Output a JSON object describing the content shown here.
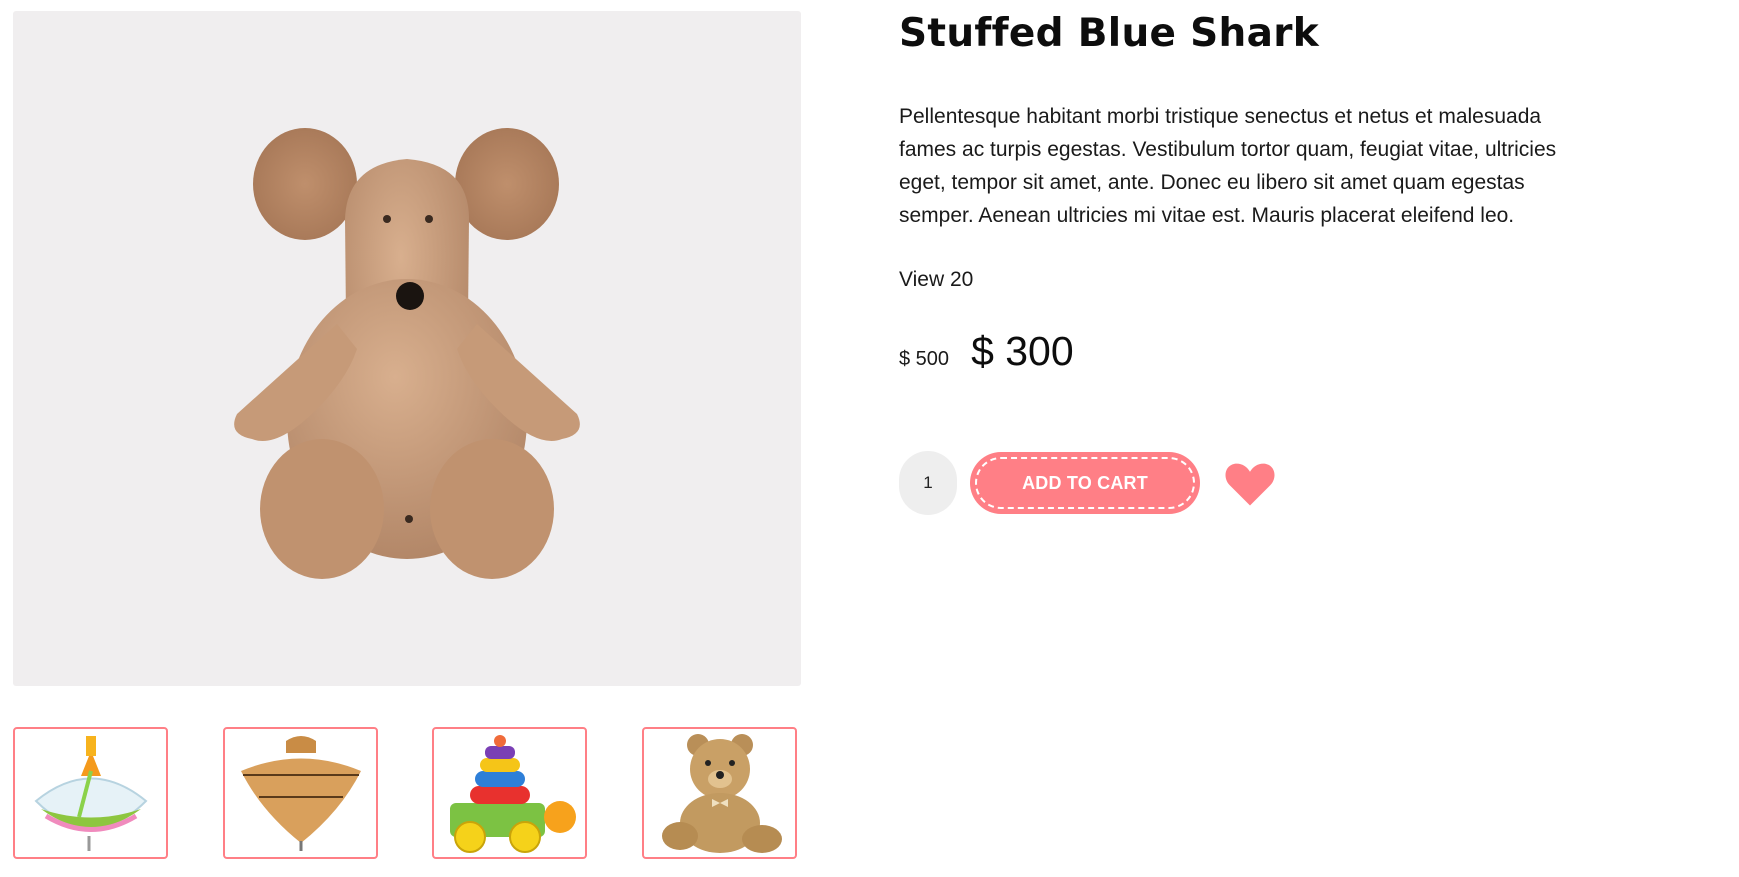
{
  "product": {
    "title": "Stuffed Blue Shark",
    "description": "Pellentesque habitant morbi tristique senectus et netus et malesuada fames ac turpis egestas. Vestibulum tortor quam, feugiat vitae, ultricies eget, tempor sit amet, ante. Donec eu libero sit amet quam egestas semper. Aenean ultricies mi vitae est. Mauris placerat eleifend leo.",
    "views": "View 20",
    "old_price": "$ 500",
    "price": "$ 300"
  },
  "cart": {
    "quantity": "1",
    "add_label": "ADD TO CART"
  },
  "gallery": {
    "main_image": "plush-mouse-image",
    "thumbnails": [
      "spinning-top-image",
      "wooden-top-image",
      "stacking-rings-turtle-image",
      "teddy-bear-image"
    ]
  },
  "colors": {
    "accent": "#ff7f86",
    "image_background": "#f0eeef",
    "qty_background": "#eeeeee"
  }
}
